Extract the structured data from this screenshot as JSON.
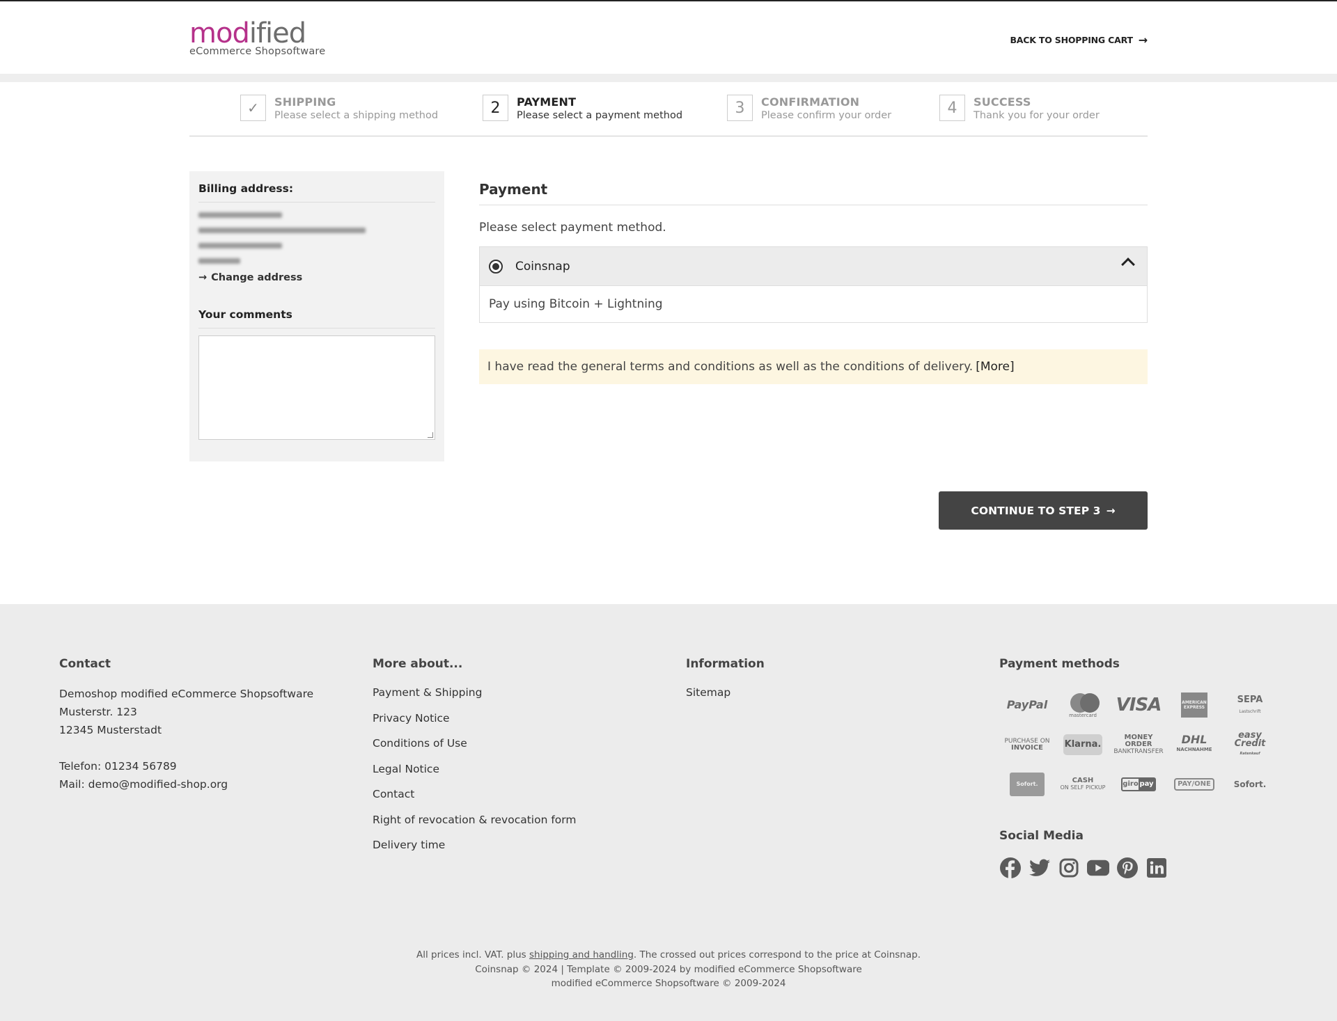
{
  "header": {
    "logo": {
      "word_part1": "mod",
      "word_part2": "ified",
      "tagline": "eCommerce Shopsoftware"
    },
    "back_link": "BACK TO SHOPPING CART"
  },
  "steps": [
    {
      "number": "",
      "title": "SHIPPING",
      "subtitle": "Please select a shipping method",
      "state": "done"
    },
    {
      "number": "2",
      "title": "PAYMENT",
      "subtitle": "Please select a payment method",
      "state": "active"
    },
    {
      "number": "3",
      "title": "CONFIRMATION",
      "subtitle": "Please confirm your order",
      "state": "pending"
    },
    {
      "number": "4",
      "title": "SUCCESS",
      "subtitle": "Thank you for your order",
      "state": "pending"
    }
  ],
  "billing": {
    "heading": "Billing address:",
    "change_address": "Change address"
  },
  "comments": {
    "heading": "Your comments",
    "value": ""
  },
  "payment": {
    "heading": "Payment",
    "intro": "Please select payment method.",
    "method": {
      "name": "Coinsnap",
      "description": "Pay using Bitcoin + Lightning",
      "selected": true
    },
    "terms": "I have read the general terms and conditions as well as the conditions of delivery.",
    "terms_more": "[More]"
  },
  "continue_button": "CONTINUE TO STEP 3",
  "footer": {
    "contact": {
      "heading": "Contact",
      "lines": [
        "Demoshop modified eCommerce Shopsoftware",
        "Musterstr. 123",
        "12345 Musterstadt",
        "",
        "Telefon: 01234 56789",
        "Mail: demo@modified-shop.org"
      ]
    },
    "more_about": {
      "heading": "More about...",
      "links": [
        "Payment & Shipping",
        "Privacy Notice",
        "Conditions of Use",
        "Legal Notice",
        "Contact",
        "Right of revocation & revocation form",
        "Delivery time"
      ]
    },
    "information": {
      "heading": "Information",
      "links": [
        "Sitemap"
      ]
    },
    "payment_methods": {
      "heading": "Payment methods",
      "logos": {
        "paypal": "PayPal",
        "mastercard": "mastercard",
        "visa": "VISA",
        "amex": "AMERICAN EXPRESS",
        "sepa": "SEPA",
        "sepa_sub": "Lastschrift",
        "invoice_top": "PURCHASE ON",
        "invoice_bottom": "INVOICE",
        "klarna": "Klarna.",
        "money_order_top": "MONEY ORDER",
        "money_order_bottom": "BANKTRANSFER",
        "dhl": "DHL",
        "dhl_sub": "NACHNAHME",
        "easycredit_top": "easy",
        "easycredit_bottom": "Credit",
        "easycredit_sub": "Ratenkauf",
        "sofort_badge": "Sofort.",
        "cash_top": "CASH",
        "cash_bottom": "ON SELF PICKUP",
        "giropay_a": "giro",
        "giropay_b": "pay",
        "payone": "PAY/ONE",
        "sofort": "Sofort."
      }
    },
    "social": {
      "heading": "Social Media",
      "icons": [
        "facebook-icon",
        "twitter-icon",
        "instagram-icon",
        "youtube-icon",
        "pinterest-icon",
        "linkedin-icon"
      ]
    },
    "legal": {
      "line1_a": "All prices incl. VAT. plus ",
      "line1_link": "shipping and handling",
      "line1_b": ". The crossed out prices correspond to the price at Coinsnap.",
      "line2": "Coinsnap © 2024 | Template © 2009-2024 by modified eCommerce Shopsoftware",
      "line3": "modified eCommerce Shopsoftware © 2009-2024"
    }
  }
}
